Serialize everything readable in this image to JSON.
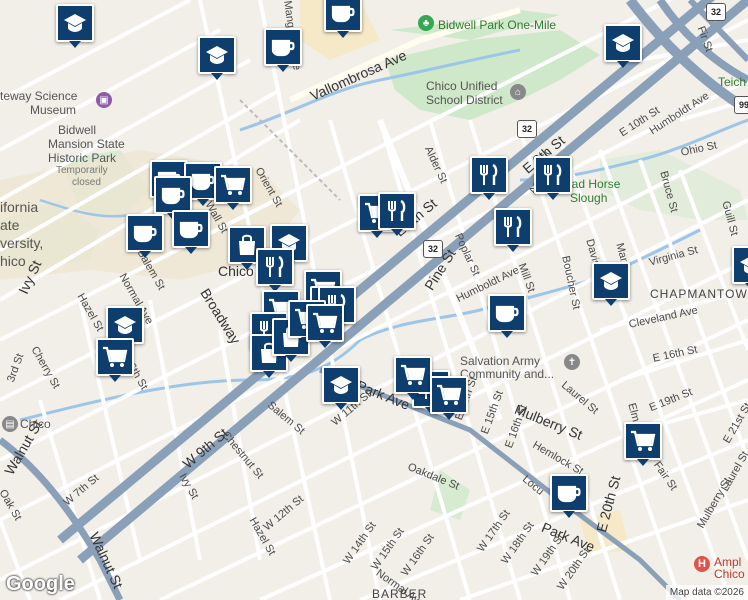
{
  "map": {
    "streets": {
      "mangrove_ave": "Mangrove Ave",
      "vallombrosa_ave": "Vallombrosa Ave",
      "fir_st": "Fir St",
      "e_10th_st": "E 10th St",
      "humboldt_ave_ne": "Humboldt Ave",
      "ohio_st": "Ohio St",
      "alder_st": "Alder St",
      "e_8th_st": "E 8th St",
      "e_9th_st": "E 9th St",
      "aspen_st": "Aspen St",
      "bruce_st": "Bruce St",
      "guill_st": "Guill St",
      "virginia_st": "Virginia St",
      "davis_st": "Davis St",
      "mar_st": "Mar",
      "poplar_st": "Poplar St",
      "humboldt_ave": "Humboldt Ave",
      "mill_st": "Mill St",
      "boucher_st": "Boucher St",
      "cleveland_ave": "Cleveland Ave",
      "orient_st": "Orient St",
      "wall_st": "Wall St",
      "salem_st": "Salem St",
      "normal_ave": "Normal Ave",
      "ivy_st": "Ivy St",
      "broadway_st": "Broadway",
      "pine_st": "Pine St",
      "e_16th_st": "E 16th St",
      "laurel_st": "Laurel St",
      "e_19th_st": "E 19th St",
      "elm_st": "Elm",
      "hazel_st": "Hazel St",
      "w_6th_st": "W 6th St",
      "cherry_st": "Cherry St",
      "w_3rd_st": "3rd St",
      "walnut_st": "Walnut St",
      "w_9th_st": "W 9th St",
      "salem_st2": "Salem St",
      "chestnut_st": "Chestnut St",
      "w_11th_st": "W 11th St",
      "park_ave": "Park Ave",
      "e_14th_st": "E 14th St",
      "e_15th_st": "E 15th St",
      "e_16th_st2": "E 16th St",
      "mulberry_st": "Mulberry St",
      "hemlock_st": "Hemlock St",
      "locust_st": "Locu",
      "e_20th_st": "E 20th St",
      "fair_st": "Fair St",
      "e_21st_st": "E 21st St",
      "laurel_st2": "Laurel St",
      "mulberry_st2": "Mulberry St",
      "oakdale_st": "Oakdale St",
      "w_7th_st": "W 7th St",
      "oak_st": "Oak St",
      "ivy_st2": "Ivy St",
      "w_12th_st": "W 12th St",
      "hazel_st2": "Hazel St",
      "w_14th_st": "W 14th St",
      "w_15th_st": "W 15th St",
      "w_16th_st": "W 16th St",
      "w_17th_st": "W 17th St",
      "w_18th_st": "W 18th St",
      "w_19th_st": "W 19th St",
      "w_20th_st": "W 20th St",
      "normal_ave2": "Normal Ave",
      "walnut_st2": "Walnut St",
      "ivy_st3": "Ivy St"
    },
    "places": {
      "bidwell_park": "Bidwell Park One-Mile",
      "chico_usd_1": "Chico Unified",
      "chico_usd_2": "School District",
      "science_museum_1": "teway Science",
      "science_museum_2": "Museum",
      "bidwell_mansion_1": "Bidwell",
      "bidwell_mansion_2": "Mansion State",
      "bidwell_mansion_3": "Historic Park",
      "bidwell_mansion_4": "Temporarily",
      "bidwell_mansion_5": "closed",
      "csu_1": "ifornia",
      "csu_2": "ate",
      "csu_3": "versity,",
      "csu_4": "hico",
      "chico": "Chico",
      "dead_horse_1": "ead Horse",
      "dead_horse_2": "Slough",
      "chapmantown": "CHAPMANTOW",
      "salvation_army_1": "Salvation Army",
      "salvation_army_2": "Community and...",
      "barber": "BARBER",
      "ampla_1": "Ampl",
      "ampla_2": "Chico",
      "teich": "Teich",
      "chico_station": "Chico"
    },
    "shields": {
      "hwy32_a": "32",
      "hwy32_b": "32",
      "hwy32_c": "32",
      "hwy99": "99"
    },
    "footer": {
      "logo": "Google",
      "attribution": "Map data ©2026"
    },
    "pins": [
      {
        "type": "school"
      },
      {
        "type": "cafe"
      },
      {
        "type": "school"
      },
      {
        "type": "cafe"
      },
      {
        "type": "school"
      },
      {
        "type": "cafe"
      },
      {
        "type": "cafe"
      },
      {
        "type": "grocery"
      },
      {
        "type": "cafe"
      },
      {
        "type": "cafe"
      },
      {
        "type": "cafe"
      },
      {
        "type": "shopping"
      },
      {
        "type": "school"
      },
      {
        "type": "restaurant"
      },
      {
        "type": "restaurant"
      },
      {
        "type": "grocery"
      },
      {
        "type": "restaurant"
      },
      {
        "type": "restaurant"
      },
      {
        "type": "grocery"
      },
      {
        "type": "shopping"
      },
      {
        "type": "school"
      },
      {
        "type": "grocery"
      },
      {
        "type": "restaurant"
      },
      {
        "type": "restaurant"
      },
      {
        "type": "cafe"
      },
      {
        "type": "restaurant"
      },
      {
        "type": "school"
      },
      {
        "type": "shopping"
      },
      {
        "type": "shopping"
      },
      {
        "type": "school"
      },
      {
        "type": "grocery"
      },
      {
        "type": "restaurant"
      },
      {
        "type": "grocery"
      },
      {
        "type": "grocery"
      },
      {
        "type": "grocery"
      },
      {
        "type": "grocery"
      },
      {
        "type": "school"
      },
      {
        "type": "cafe"
      },
      {
        "type": "grocery"
      }
    ]
  }
}
